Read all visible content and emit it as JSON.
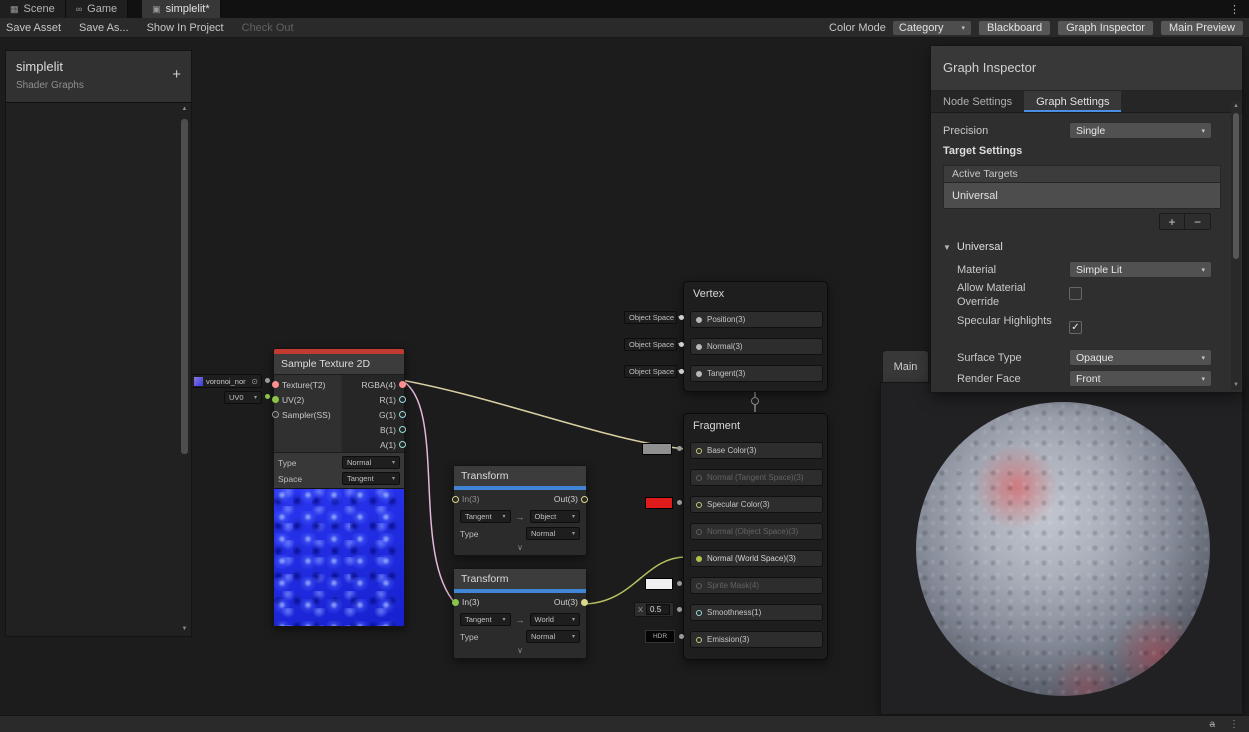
{
  "colors": {
    "accent_blue": "#4a8fe4",
    "node_category_red": "#c23b31",
    "node_category_blue": "#4185d6",
    "wire_pink": "#e2b7d9",
    "wire_beige": "#d8d0a2",
    "wire_olive": "#b9c160",
    "port_vector4": "#ff8e8e",
    "port_vector3": "#d8d88a",
    "port_connected_green": "#8ac44a",
    "preview_normal_map_blue": "#2a36f2"
  },
  "icons": {
    "menu": "⋮",
    "scene_grid": "▦",
    "game": "∞",
    "unity_asset": "▣",
    "chevron_down": "▾",
    "foldout_open": "▼",
    "scroll_up": "▲",
    "scroll_down": "▼",
    "check": "✓",
    "plus": "+",
    "minus": "−",
    "arrow_right": "→",
    "collapse": "∨",
    "object_picker": "⊙",
    "autosave": "a",
    "status_menu": "⋮"
  },
  "tabbar": {
    "scene": "Scene",
    "game": "Game",
    "shader_tab": "simplelit*"
  },
  "toolbar": {
    "save_asset": "Save Asset",
    "save_as": "Save As...",
    "show_in_project": "Show In Project",
    "check_out": "Check Out",
    "color_mode_label": "Color Mode",
    "color_mode_value": "Category",
    "blackboard_toggle": "Blackboard",
    "graph_inspector_toggle": "Graph Inspector",
    "main_preview_toggle": "Main Preview"
  },
  "blackboard": {
    "title": "simplelit",
    "subtitle": "Shader Graphs"
  },
  "inspector": {
    "title": "Graph Inspector",
    "tab_node": "Node Settings",
    "tab_graph": "Graph Settings",
    "precision_label": "Precision",
    "precision_value": "Single",
    "target_settings_heading": "Target Settings",
    "active_targets_heading": "Active Targets",
    "active_target_item": "Universal",
    "universal_foldout": "Universal",
    "material_label": "Material",
    "material_value": "Simple Lit",
    "allow_material_override_label": "Allow Material Override",
    "specular_highlights_label": "Specular Highlights",
    "surface_type_label": "Surface Type",
    "surface_type_value": "Opaque",
    "render_face_label": "Render Face",
    "render_face_value": "Front"
  },
  "preview": {
    "tab": "Main"
  },
  "graph": {
    "sample_node": {
      "title": "Sample Texture 2D",
      "texture_value": "voronoi_nor",
      "uv_value": "UV0",
      "in_texture": "Texture(T2)",
      "in_uv": "UV(2)",
      "in_sampler": "Sampler(SS)",
      "out_rgba": "RGBA(4)",
      "out_r": "R(1)",
      "out_g": "G(1)",
      "out_b": "B(1)",
      "out_a": "A(1)",
      "type_label": "Type",
      "type_value": "Normal",
      "space_label": "Space",
      "space_value": "Tangent"
    },
    "transform1": {
      "title": "Transform",
      "in_port": "In(3)",
      "out_port": "Out(3)",
      "from_space": "Tangent",
      "to_space": "Object",
      "type_label": "Type",
      "type_value": "Normal"
    },
    "transform2": {
      "title": "Transform",
      "in_port": "In(3)",
      "out_port": "Out(3)",
      "from_space": "Tangent",
      "to_space": "World",
      "type_label": "Type",
      "type_value": "Normal"
    },
    "vertex": {
      "title": "Vertex",
      "space_value": "Object Space",
      "ports": [
        {
          "label": "Position(3)"
        },
        {
          "label": "Normal(3)"
        },
        {
          "label": "Tangent(3)"
        }
      ]
    },
    "fragment": {
      "title": "Fragment",
      "ports": [
        {
          "label": "Base Color(3)"
        },
        {
          "label": "Normal (Tangent Space)(3)"
        },
        {
          "label": "Specular Color(3)"
        },
        {
          "label": "Normal (Object Space)(3)"
        },
        {
          "label": "Normal (World Space)(3)"
        },
        {
          "label": "Sprite Mask(4)"
        },
        {
          "label": "Smoothness(1)"
        },
        {
          "label": "Emission(3)"
        }
      ],
      "smoothness_x": "X",
      "smoothness_value": "0.5",
      "hdr_label": "HDR"
    }
  }
}
